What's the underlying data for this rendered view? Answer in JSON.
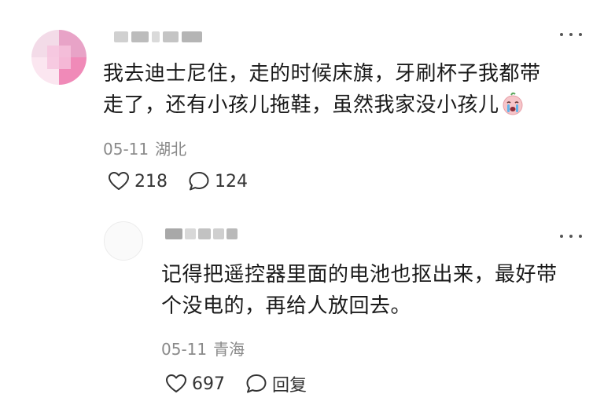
{
  "comment": {
    "line1": "我去迪士尼住，走的时候床旗，牙刷杯子我都带",
    "line2": "走了，还有小孩儿拖鞋，虽然我家没小孩儿",
    "emoji": "crying-face-emoji",
    "date": "05-11",
    "location": "湖北",
    "likes": "218",
    "replies": "124"
  },
  "reply": {
    "line1": "记得把遥控器里面的电池也抠出来，最好带",
    "line2": "个没电的，再给人放回去。",
    "date": "05-11",
    "location": "青海",
    "likes": "697",
    "reply_label": "回复"
  },
  "colors": {
    "text": "#1a1a1a",
    "meta": "#8a8a8a",
    "icon": "#333333"
  }
}
